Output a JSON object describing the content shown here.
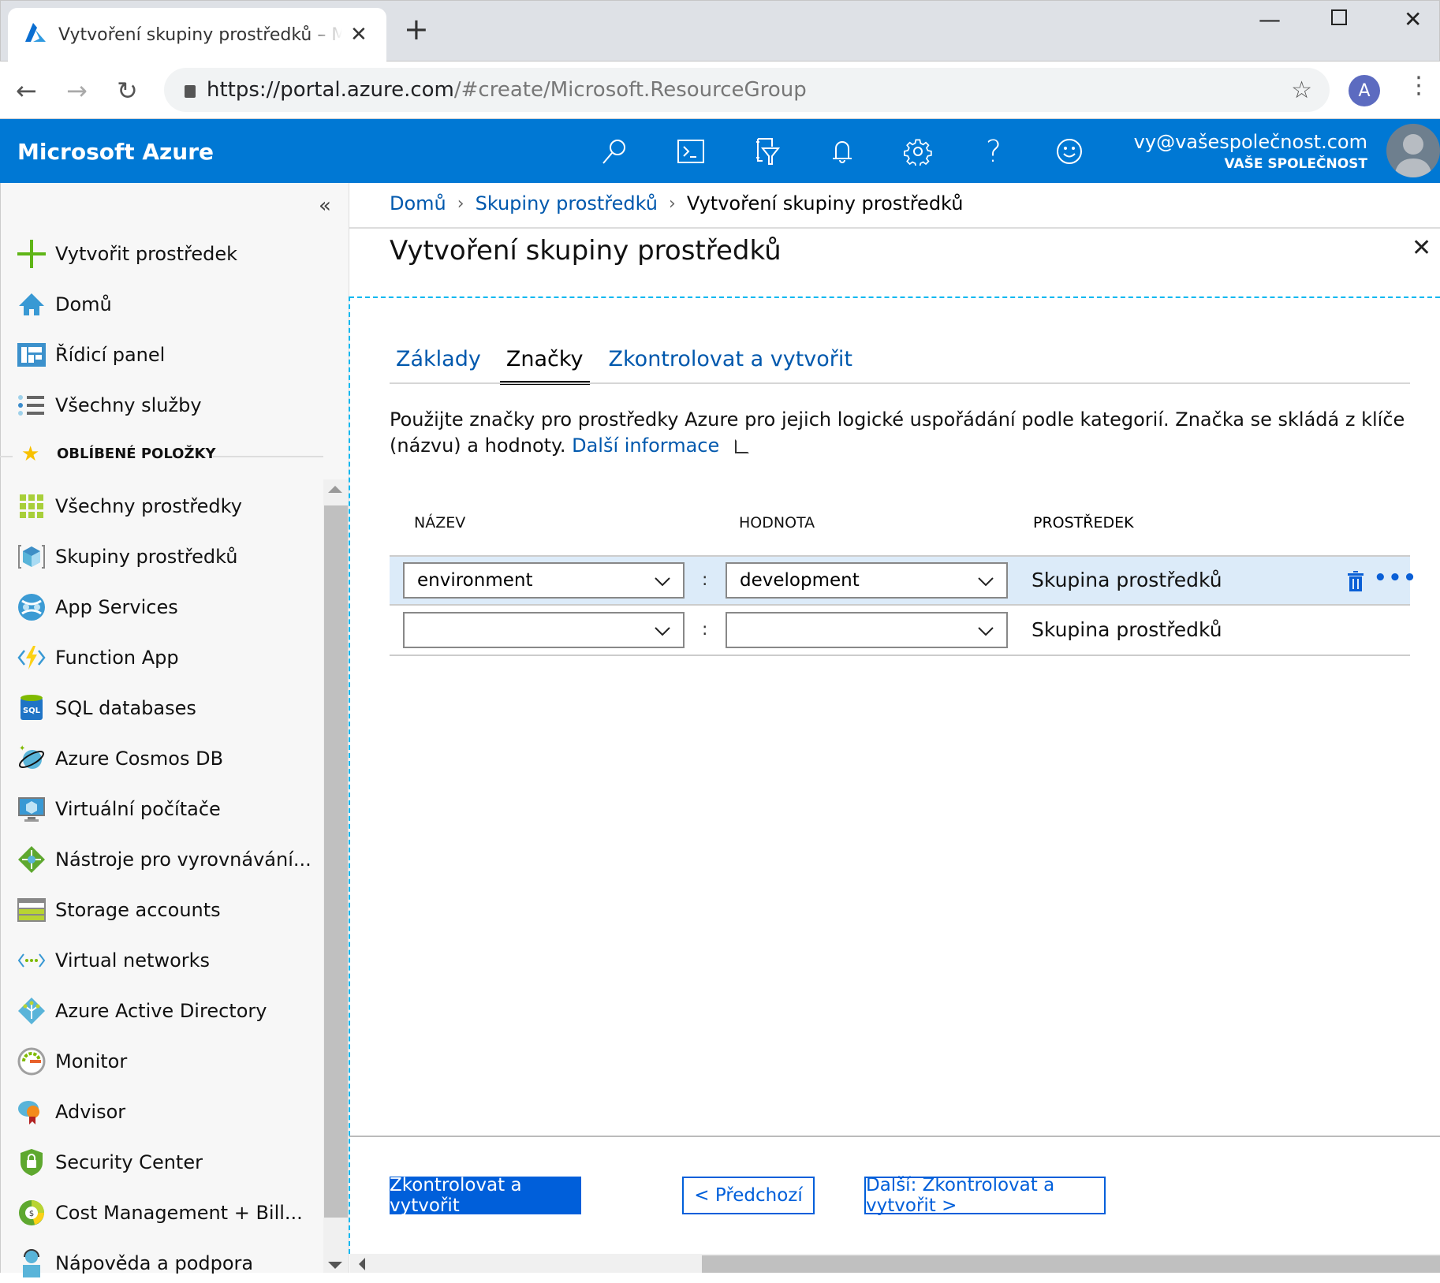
{
  "browser": {
    "tab_title": "Vytvoření skupiny prostředků – Microsoft Azure",
    "new_tab": "+",
    "url_host": "https://portal.azure.com",
    "url_path": "/#create/Microsoft.ResourceGroup",
    "profile_initial": "A"
  },
  "header": {
    "brand": "Microsoft Azure",
    "icons": [
      "search-icon",
      "cloud-shell-icon",
      "directory-filter-icon",
      "notifications-icon",
      "settings-icon",
      "help-icon",
      "feedback-icon"
    ],
    "user_email": "vy@vašespolečnost.com",
    "user_org": "VAŠE SPOLEČNOST"
  },
  "sidebar": {
    "collapse_label": "«",
    "top_items": [
      {
        "label": "Vytvořit prostředek",
        "icon": "plus-icon"
      },
      {
        "label": "Domů",
        "icon": "home-icon"
      },
      {
        "label": "Řídicí panel",
        "icon": "dashboard-icon"
      },
      {
        "label": "Všechny služby",
        "icon": "list-icon"
      }
    ],
    "favorites_label": "OBLÍBENÉ POLOŽKY",
    "favorites": [
      {
        "label": "Všechny prostředky",
        "icon": "all-resources-icon"
      },
      {
        "label": "Skupiny prostředků",
        "icon": "resource-groups-icon"
      },
      {
        "label": "App Services",
        "icon": "app-services-icon"
      },
      {
        "label": "Function App",
        "icon": "function-app-icon"
      },
      {
        "label": "SQL databases",
        "icon": "sql-database-icon"
      },
      {
        "label": "Azure Cosmos DB",
        "icon": "cosmos-db-icon"
      },
      {
        "label": "Virtuální počítače",
        "icon": "virtual-machine-icon"
      },
      {
        "label": "Nástroje pro vyrovnávání...",
        "icon": "load-balancer-icon"
      },
      {
        "label": "Storage accounts",
        "icon": "storage-icon"
      },
      {
        "label": "Virtual networks",
        "icon": "virtual-network-icon"
      },
      {
        "label": "Azure Active Directory",
        "icon": "active-directory-icon"
      },
      {
        "label": "Monitor",
        "icon": "monitor-icon"
      },
      {
        "label": "Advisor",
        "icon": "advisor-icon"
      },
      {
        "label": "Security Center",
        "icon": "security-center-icon"
      },
      {
        "label": "Cost Management + Bill...",
        "icon": "cost-management-icon"
      },
      {
        "label": "Nápověda a podpora",
        "icon": "help-support-icon"
      }
    ]
  },
  "breadcrumb": [
    "Domů",
    "Skupiny prostředků",
    "Vytvoření skupiny prostředků"
  ],
  "blade": {
    "title": "Vytvoření skupiny prostředků",
    "tabs": [
      {
        "label": "Základy",
        "active": false
      },
      {
        "label": "Značky",
        "active": true
      },
      {
        "label": "Zkontrolovat a vytvořit",
        "active": false
      }
    ],
    "description": "Použijte značky pro prostředky Azure pro jejich logické uspořádání podle kategorií. Značka se skládá z klíče (názvu) a hodnoty.",
    "learn_more": "Další informace",
    "table": {
      "headers": [
        "NÁZEV",
        "HODNOTA",
        "PROSTŘEDEK"
      ],
      "rows": [
        {
          "name": "environment",
          "value": "development",
          "resource": "Skupina prostředků",
          "highlight": true
        },
        {
          "name": "",
          "value": "",
          "resource": "Skupina prostředků",
          "highlight": false
        }
      ],
      "separator": ":"
    },
    "buttons": {
      "primary": "Zkontrolovat a vytvořit",
      "prev": "< Předchozí",
      "next": "Další: Zkontrolovat a vytvořit >"
    }
  },
  "colors": {
    "azure_blue": "#0078d4",
    "link": "#0058ad",
    "button": "#005fda",
    "row_highlight": "#dcebf9",
    "focus_dash": "#00b7f0"
  }
}
